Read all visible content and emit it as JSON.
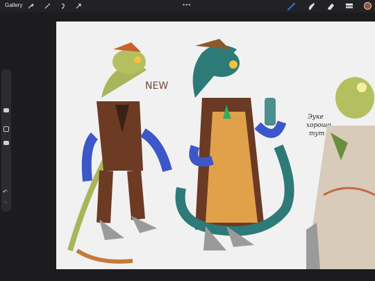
{
  "toolbar": {
    "gallery_label": "Gallery",
    "left_tools": [
      "wrench-icon",
      "magic-wand-icon",
      "selection-icon",
      "transform-icon"
    ],
    "more_label": "•••",
    "right_tools": [
      "brush-icon",
      "smudge-icon",
      "eraser-icon",
      "layers-icon"
    ],
    "active_tool": "brush-icon",
    "current_color": "#a0522d"
  },
  "sidebar": {
    "undo_label": "↶",
    "redo_label": "↷"
  },
  "canvas": {
    "annotation_new": "NEW",
    "annotation_note_line1": "Эуке",
    "annotation_note_line2": "хорошо",
    "annotation_note_line3": "тут"
  },
  "colors": {
    "canvas_bg": "#f1f1f1",
    "chrome_bg": "#222224",
    "accent_blue": "#2f6fd6"
  }
}
